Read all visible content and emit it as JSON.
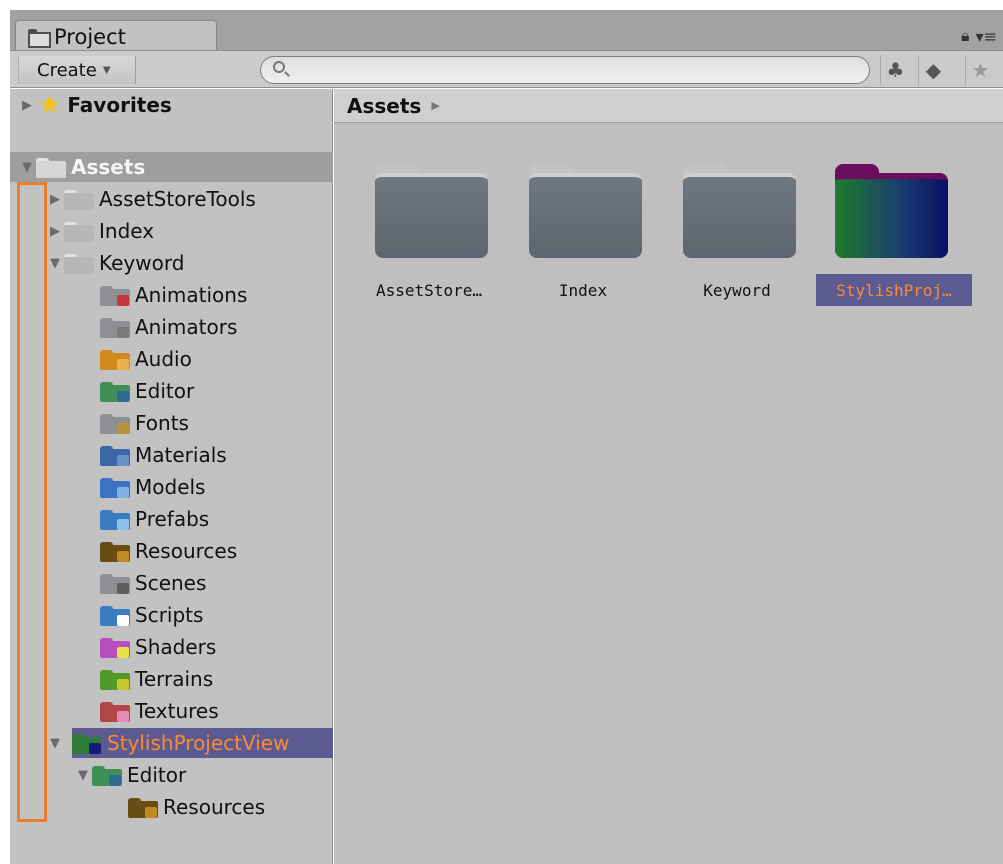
{
  "window": {
    "tab_label": "Project",
    "lock_icon": "lock-icon",
    "menu_icon": "panel-menu-icon"
  },
  "toolbar": {
    "create_label": "Create",
    "search_placeholder": "",
    "buttons": [
      "filter-by-type-icon",
      "filter-by-label-icon",
      "favorite-star-icon"
    ]
  },
  "tree": {
    "favorites_label": "Favorites",
    "assets_label": "Assets",
    "items": [
      {
        "label": "AssetStoreTools",
        "color": "#6c6f73"
      },
      {
        "label": "Index",
        "color": "#6c6f73"
      },
      {
        "label": "Keyword",
        "color": "#6c6f73"
      },
      {
        "label": "Animations",
        "color": "#8d8f93",
        "accent": "#c9353e"
      },
      {
        "label": "Animators",
        "color": "#8d8f93",
        "accent": "#7b7b7b"
      },
      {
        "label": "Audio",
        "color": "#d08a1e",
        "accent": "#e7b34a"
      },
      {
        "label": "Editor",
        "color": "#3e8f55",
        "accent": "#2e6a8f"
      },
      {
        "label": "Fonts",
        "color": "#8d8f93",
        "accent": "#b7953a"
      },
      {
        "label": "Materials",
        "color": "#3b66a8",
        "accent": "#6a90c8"
      },
      {
        "label": "Models",
        "color": "#3b73c2",
        "accent": "#7fb3e6"
      },
      {
        "label": "Prefabs",
        "color": "#3b7cbf",
        "accent": "#8cc3ee"
      },
      {
        "label": "Resources",
        "color": "#6a4d14",
        "accent": "#c08a22"
      },
      {
        "label": "Scenes",
        "color": "#8d8f93",
        "accent": "#5d5d5d"
      },
      {
        "label": "Scripts",
        "color": "#3b7cbf",
        "accent": "#ffffff"
      },
      {
        "label": "Shaders",
        "color": "#b64fbd",
        "accent": "#e6e04a"
      },
      {
        "label": "Terrains",
        "color": "#4f9a2a",
        "accent": "#c8c82a"
      },
      {
        "label": "Textures",
        "color": "#b34646",
        "accent": "#e88ab8"
      },
      {
        "label": "StylishProjectView",
        "color": "#2c7b3a",
        "accent": "#141a7a"
      },
      {
        "label": "Editor",
        "color": "#3e8f55",
        "accent": "#2e6a8f"
      },
      {
        "label": "Resources",
        "color": "#6a4d14",
        "accent": "#c08a22"
      }
    ]
  },
  "browser": {
    "breadcrumb": "Assets",
    "items": [
      {
        "label": "AssetStore…",
        "top_color": "#c4c4c4",
        "body_color": "#5d6670"
      },
      {
        "label": "Index",
        "top_color": "#c4c4c4",
        "body_color": "#5d6670"
      },
      {
        "label": "Keyword",
        "top_color": "#c4c4c4",
        "body_color": "#5d6670"
      },
      {
        "label": "StylishProj…",
        "top_color": "#6a0d5c",
        "body_color": "#1b6a4a"
      }
    ]
  },
  "colors": {
    "selection": "#5b5b92",
    "selection_text": "#ff8a33",
    "highlight_box": "#ef7b2e"
  }
}
